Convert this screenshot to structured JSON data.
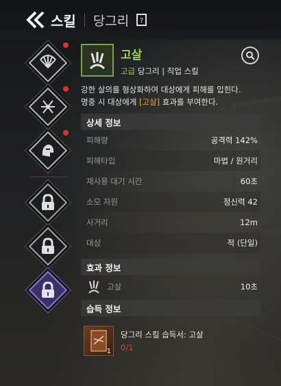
{
  "header": {
    "title": "스킬",
    "subtitle": "당그리"
  },
  "left_slots": [
    {
      "icon": "fan-sigil-icon",
      "badge": true,
      "locked": false
    },
    {
      "icon": "rune-sigil-icon",
      "badge": true,
      "locked": false
    },
    {
      "icon": "helmet-icon",
      "badge": true,
      "locked": false
    },
    {
      "icon": "lock-icon",
      "badge": false,
      "locked": true
    },
    {
      "icon": "lock-icon",
      "badge": false,
      "locked": true
    },
    {
      "icon": "lock-icon",
      "badge": false,
      "locked": true,
      "accent": "#8d7cc8"
    }
  ],
  "skill": {
    "name": "고살",
    "grade": "고급",
    "class": "당그리",
    "type": "직업 스킬",
    "desc_line1": "강한 살의를 형상화하여 대상에게 피해를 입힌다.",
    "desc_line2_pre": "명중 시 대상에게 ",
    "desc_line2_hl": "[고살]",
    "desc_line2_post": " 효과를 부여한다.",
    "name_color": "#9ccf5e"
  },
  "details": {
    "heading": "상세 정보",
    "rows": [
      {
        "label": "피해량",
        "value": "공격력 142%"
      },
      {
        "label": "피해타입",
        "value": "마법 / 원거리"
      },
      {
        "label": "재사용 대기 시간",
        "value": "60초"
      },
      {
        "label": "소모 자원",
        "value": "정신력 42"
      },
      {
        "label": "사거리",
        "value": "12m"
      },
      {
        "label": "대상",
        "value": "적 (단일)"
      }
    ]
  },
  "effects": {
    "heading": "효과 정보",
    "items": [
      {
        "name": "고살",
        "value": "10초"
      }
    ]
  },
  "acquire": {
    "heading": "습득 정보",
    "item_name": "당그리 스킬 습득서: 고살",
    "item_stack": "1",
    "owned": "0/1"
  }
}
